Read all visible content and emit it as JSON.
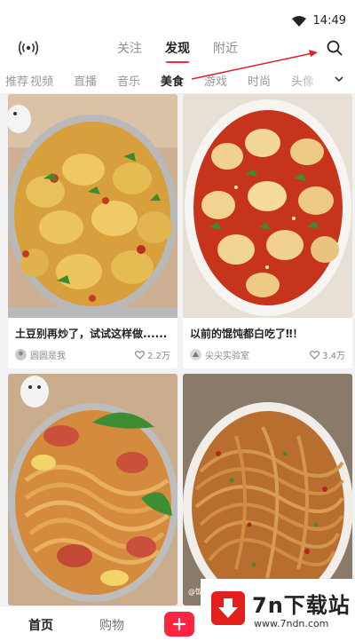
{
  "status_bar": {
    "time": "14:49"
  },
  "top_nav": {
    "tabs": [
      {
        "label": "关注",
        "active": false
      },
      {
        "label": "发现",
        "active": true
      },
      {
        "label": "附近",
        "active": false
      }
    ],
    "left_icon": "live-broadcast-icon",
    "right_icon": "search-icon"
  },
  "category_bar": {
    "items": [
      "推荐",
      "视频",
      "直播",
      "音乐",
      "美食",
      "游戏",
      "时尚",
      "头像"
    ],
    "active": "美食",
    "expand_icon": "chevron-down-icon"
  },
  "feed": {
    "cards": [
      {
        "title": "土豆别再炒了，试试这样做......",
        "author": "圆圆是我",
        "likes": "2.2万"
      },
      {
        "title": "以前的馄饨都白吃了‼！",
        "author": "尖尖实验室",
        "likes": "3.4万"
      },
      {
        "title": "",
        "author": "",
        "likes": ""
      },
      {
        "title": "",
        "author": "",
        "likes": ""
      }
    ],
    "card3_image_caption": "@饭桶菜小菜"
  },
  "bottom_nav": {
    "items": [
      {
        "label": "首页",
        "active": true
      },
      {
        "label": "购物",
        "active": false
      }
    ],
    "publish_icon": "plus-icon"
  },
  "watermark": {
    "brand": "7n下载站",
    "url": "www.7ndn.com"
  },
  "colors": {
    "accent": "#ff2442",
    "annotation_arrow": "#d9232e"
  }
}
